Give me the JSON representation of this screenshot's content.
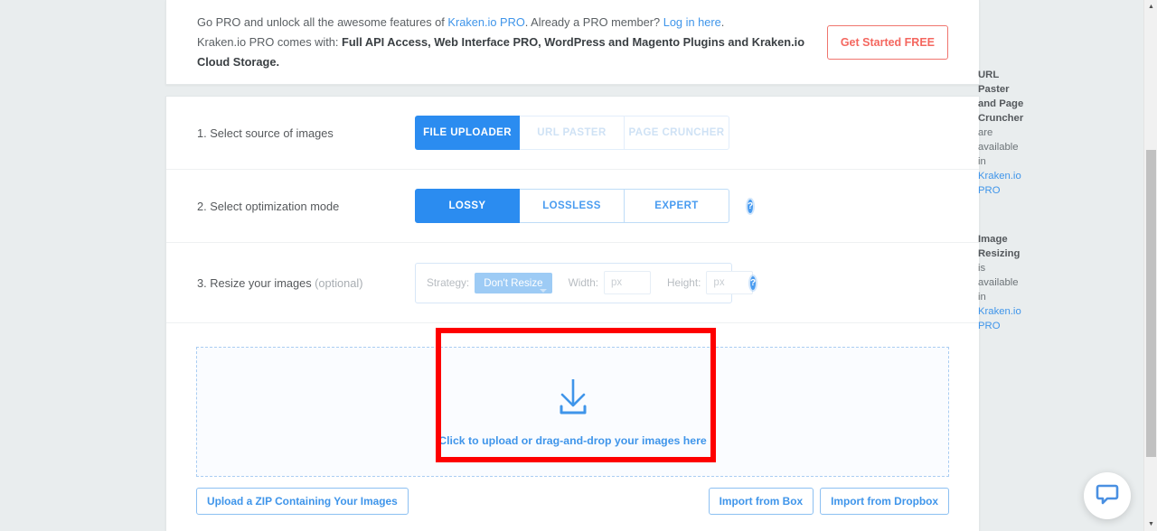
{
  "banner": {
    "line1_pre": "Go PRO and unlock all the awesome features of ",
    "line1_link1": "Kraken.io PRO",
    "line1_mid": ". Already a PRO member? ",
    "line1_link2": "Log in here",
    "line1_end": ".",
    "line2_pre": "Kraken.io PRO comes with: ",
    "line2_bold": "Full API Access, Web Interface PRO, WordPress and Magento Plugins and Kraken.io Cloud Storage.",
    "cta_label": "Get Started FREE",
    "cta_color": "#f4675f"
  },
  "steps": [
    {
      "label": "1. Select source of images",
      "optional": "",
      "options": [
        {
          "label": "FILE UPLOADER",
          "state": "active"
        },
        {
          "label": "URL PASTER",
          "state": "disabled"
        },
        {
          "label": "PAGE CRUNCHER",
          "state": "disabled"
        }
      ],
      "help": false,
      "aside_pre": "URL Paster and Page Cruncher",
      "aside_mid": "are available in ",
      "aside_link": "Kraken.io PRO"
    },
    {
      "label": "2. Select optimization mode",
      "optional": "",
      "options": [
        {
          "label": "LOSSY",
          "state": "active"
        },
        {
          "label": "LOSSLESS",
          "state": "normal"
        },
        {
          "label": "EXPERT",
          "state": "normal"
        }
      ],
      "help": true,
      "help_glyph": "?",
      "aside_pre": "",
      "aside_mid": "",
      "aside_link": ""
    }
  ],
  "resize": {
    "label": "3. Resize your images ",
    "optional": "(optional)",
    "strategy_label": "Strategy:",
    "strategy_value": "Don't Resize",
    "width_label": "Width:",
    "width_value": "",
    "width_placeholder": "px",
    "height_label": "Height:",
    "height_value": "",
    "height_placeholder": "px",
    "help_glyph": "?",
    "aside_bold": "Image Resizing",
    "aside_text": " is available in",
    "aside_link": "Kraken.io PRO"
  },
  "dropzone": {
    "text": "Click to upload or drag-and-drop your images here",
    "icon": "download-arrow-icon",
    "accent": "#3f95ea",
    "highlight_color": "#fe0000"
  },
  "actions": {
    "zip": "Upload a ZIP Containing Your Images",
    "box": "Import from Box",
    "dropbox": "Import from Dropbox"
  },
  "chat": {
    "icon": "chat-bubble-icon",
    "color": "#4a90e2"
  },
  "scrollbar": {
    "up_glyph": "▲",
    "down_glyph": "▼"
  }
}
